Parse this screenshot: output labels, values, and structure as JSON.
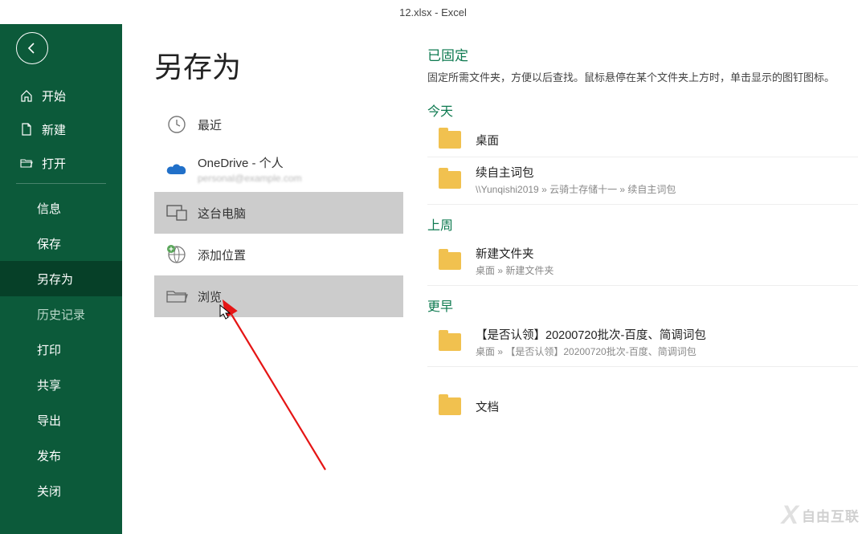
{
  "title_bar": "12.xlsx  -  Excel",
  "sidebar": {
    "items": [
      {
        "label": "开始"
      },
      {
        "label": "新建"
      },
      {
        "label": "打开"
      },
      {
        "label": "信息"
      },
      {
        "label": "保存"
      },
      {
        "label": "另存为"
      },
      {
        "label": "历史记录"
      },
      {
        "label": "打印"
      },
      {
        "label": "共享"
      },
      {
        "label": "导出"
      },
      {
        "label": "发布"
      },
      {
        "label": "关闭"
      }
    ]
  },
  "page_title": "另存为",
  "locations": {
    "recent": "最近",
    "onedrive": "OneDrive - 个人",
    "onedrive_sub": "personal@example.com",
    "this_pc": "这台电脑",
    "add_place": "添加位置",
    "browse": "浏览"
  },
  "right": {
    "pinned_title": "已固定",
    "pinned_desc": "固定所需文件夹，方便以后查找。鼠标悬停在某个文件夹上方时，单击显示的图钉图标。",
    "groups": [
      {
        "title": "今天",
        "items": [
          {
            "name": "桌面",
            "path": ""
          },
          {
            "name": "续自主词包",
            "path": "\\\\Yunqishi2019 » 云骑士存储十一 » 续自主词包"
          }
        ]
      },
      {
        "title": "上周",
        "items": [
          {
            "name": "新建文件夹",
            "path": "桌面 » 新建文件夹"
          }
        ]
      },
      {
        "title": "更早",
        "items": [
          {
            "name": "【是否认领】20200720批次-百度、简调词包",
            "path": "桌面 » 【是否认领】20200720批次-百度、简调词包"
          },
          {
            "name": "文档",
            "path": ""
          }
        ]
      }
    ]
  },
  "watermark": "自由互联"
}
